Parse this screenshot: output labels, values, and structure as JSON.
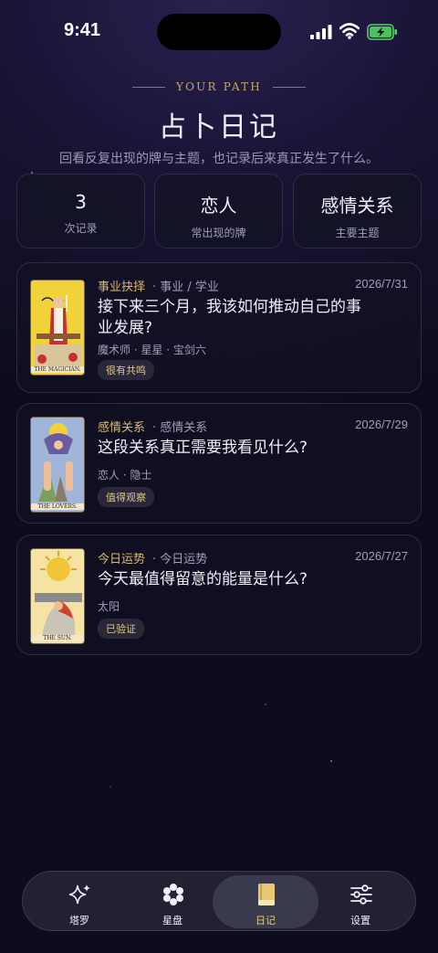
{
  "status_bar": {
    "time": "9:41"
  },
  "header": {
    "eyebrow": "YOUR PATH",
    "title": "占卜日记",
    "subtitle": "回看反复出现的牌与主题，也记录后来真正发生了什么。"
  },
  "stats": [
    {
      "value": "3",
      "label": "次记录"
    },
    {
      "value": "恋人",
      "label": "常出现的牌"
    },
    {
      "value": "感情关系",
      "label": "主要主题"
    }
  ],
  "entries": [
    {
      "category": "事业抉择",
      "topic": "· 事业 / 学业",
      "date": "2026/7/31",
      "question": "接下来三个月，我该如何推动自己的事业发展?",
      "cards": "魔术师 · 星星 · 宝剑六",
      "tag": "很有共鸣",
      "thumb_name": "THE MAGICIAN.",
      "thumb_icon": "magician-card-icon"
    },
    {
      "category": "感情关系",
      "topic": "· 感情关系",
      "date": "2026/7/29",
      "question": "这段关系真正需要我看见什么?",
      "cards": "恋人 · 隐士",
      "tag": "值得观察",
      "thumb_name": "THE LOVERS.",
      "thumb_icon": "lovers-card-icon"
    },
    {
      "category": "今日运势",
      "topic": "· 今日运势",
      "date": "2026/7/27",
      "question": "今天最值得留意的能量是什么?",
      "cards": "太阳",
      "tag": "已验证",
      "thumb_name": "THE SUN.",
      "thumb_icon": "sun-card-icon"
    }
  ],
  "tabbar": {
    "tabs": [
      {
        "label": "塔罗",
        "icon": "sparkle-icon"
      },
      {
        "label": "星盘",
        "icon": "flower-dots-icon"
      },
      {
        "label": "日记",
        "icon": "book-icon",
        "active": true
      },
      {
        "label": "设置",
        "icon": "sliders-icon"
      }
    ]
  },
  "colors": {
    "accent_gold": "#d9b870",
    "background": "#0c0c1c",
    "card_border": "#2d2b47"
  }
}
